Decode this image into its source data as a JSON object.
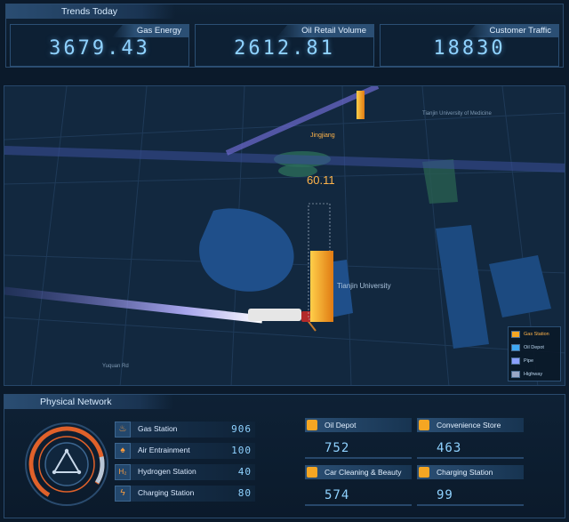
{
  "trends": {
    "title": "Trends Today",
    "kpis": [
      {
        "label": "Gas Energy",
        "value": "3679.43"
      },
      {
        "label": "Oil Retail Volume",
        "value": "2612.81"
      },
      {
        "label": "Customer Traffic",
        "value": "18830"
      }
    ]
  },
  "map": {
    "labels": {
      "station": "Jingjiang",
      "university": "Tianjin University",
      "medicine": "Tianjin University of Medicine",
      "road": "Yuquan Rd"
    },
    "bar_value": "60.11",
    "legend": [
      {
        "label": "Gas Station",
        "color": "#f5a623"
      },
      {
        "label": "Oil Depot",
        "color": "#3fa9f5"
      },
      {
        "label": "Pipe",
        "color": "#8aa0ff"
      },
      {
        "label": "Highway",
        "color": "#9aa7c7"
      }
    ]
  },
  "network": {
    "title": "Physical Network",
    "rows": [
      {
        "label": "Gas Station",
        "value": "906",
        "icon": "flame-icon"
      },
      {
        "label": "Air Entrainment",
        "value": "100",
        "icon": "air-icon"
      },
      {
        "label": "Hydrogen Station",
        "value": "40",
        "icon": "hydrogen-icon"
      },
      {
        "label": "Charging Station",
        "value": "80",
        "icon": "lightning-icon"
      }
    ],
    "cards": [
      {
        "label": "Oil Depot",
        "value": "752",
        "icon": "oil-tank-icon"
      },
      {
        "label": "Convenience Store",
        "value": "463",
        "icon": "store-icon"
      },
      {
        "label": "Car Cleaning & Beauty",
        "value": "574",
        "icon": "car-icon"
      },
      {
        "label": "Charging Station",
        "value": "99",
        "icon": "charger-icon"
      }
    ]
  },
  "colors": {
    "accent": "#f5a623",
    "value_blue": "#8fd2ff",
    "panel_border": "#2a4b6e"
  }
}
